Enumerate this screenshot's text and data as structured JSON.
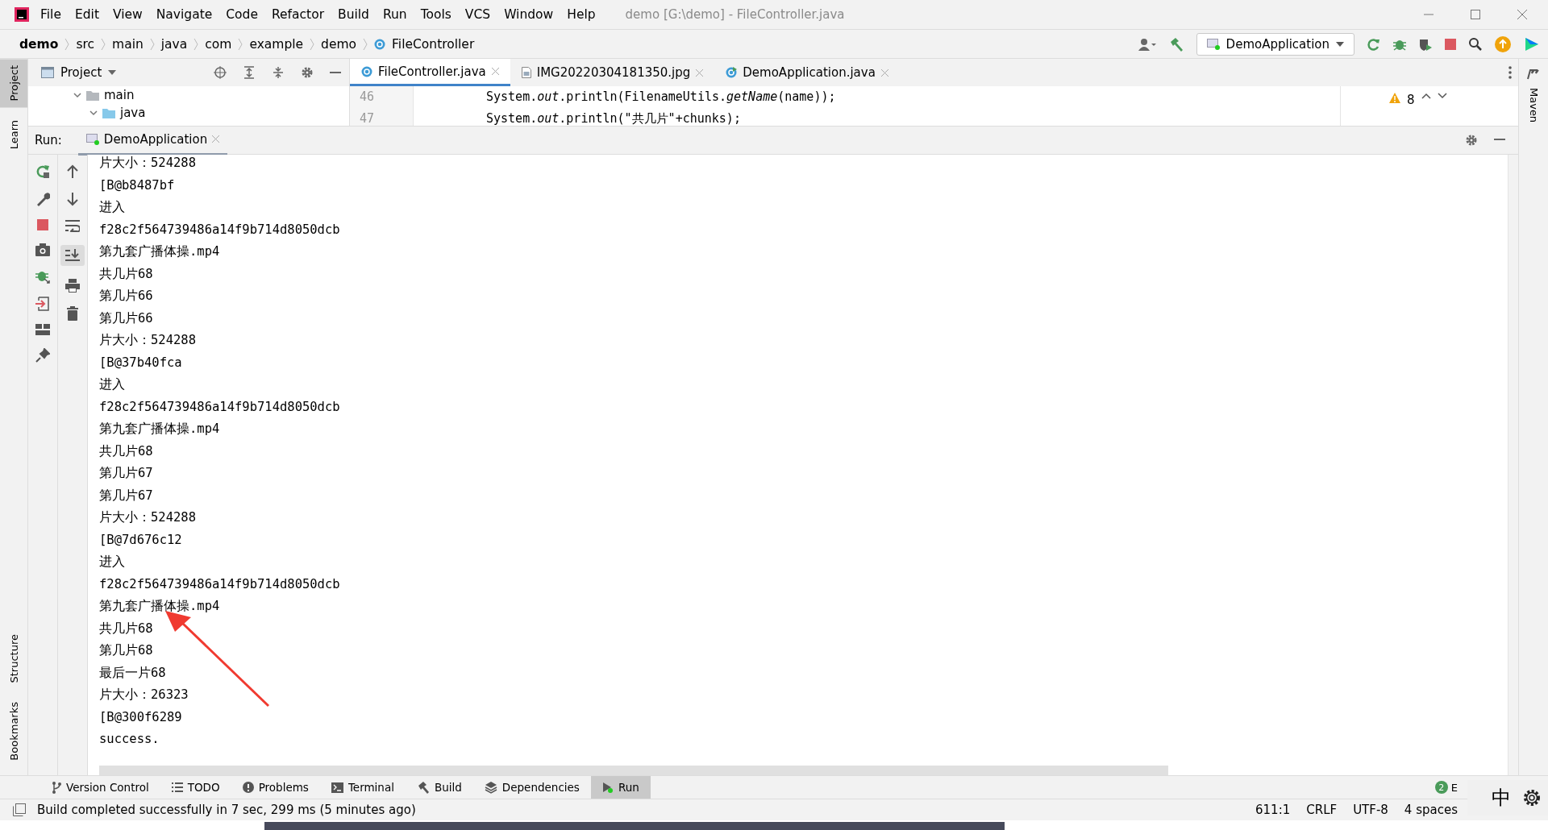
{
  "window": {
    "title": "demo [G:\\demo] - FileController.java"
  },
  "menu": [
    "File",
    "Edit",
    "View",
    "Navigate",
    "Code",
    "Refactor",
    "Build",
    "Run",
    "Tools",
    "VCS",
    "Window",
    "Help"
  ],
  "breadcrumbs": [
    {
      "label": "demo",
      "kind": "project"
    },
    {
      "label": "src",
      "kind": "folder"
    },
    {
      "label": "main",
      "kind": "folder"
    },
    {
      "label": "java",
      "kind": "folder"
    },
    {
      "label": "com",
      "kind": "folder"
    },
    {
      "label": "example",
      "kind": "folder"
    },
    {
      "label": "demo",
      "kind": "folder"
    },
    {
      "label": "FileController",
      "kind": "class"
    }
  ],
  "run_configuration": "DemoApplication",
  "left_strip": [
    {
      "label": "Project",
      "selected": true
    },
    {
      "label": "Learn",
      "selected": false
    }
  ],
  "left_strip_bottom": [
    {
      "label": "Structure",
      "selected": false
    },
    {
      "label": "Bookmarks",
      "selected": false
    }
  ],
  "right_strip": [
    {
      "label": "Maven",
      "selected": false
    }
  ],
  "project_panel": {
    "title": "Project",
    "tree": [
      {
        "label": "main",
        "expanded": true,
        "children": [
          {
            "label": "java",
            "expanded": true
          }
        ]
      }
    ]
  },
  "editor_tabs": [
    {
      "label": "FileController.java",
      "kind": "class",
      "selected": true
    },
    {
      "label": "IMG20220304181350.jpg",
      "kind": "image",
      "selected": false
    },
    {
      "label": "DemoApplication.java",
      "kind": "app",
      "selected": false
    }
  ],
  "code_lines": [
    {
      "number": "46",
      "code": "System.*out*.println(FilenameUtils.*getName*(name));"
    },
    {
      "number": "47",
      "code": "System.*out*.println(\"共几片\"+chunks);"
    }
  ],
  "warnings": "8",
  "run_panel": {
    "label": "Run:",
    "tab": "DemoApplication",
    "console": [
      "片大小：524288",
      "[B@b8487bf",
      "进入",
      "f28c2f564739486a14f9b714d8050dcb",
      "第九套广播体操.mp4",
      "共几片68",
      "第几片66",
      "第几片66",
      "片大小：524288",
      "[B@37b40fca",
      "进入",
      "f28c2f564739486a14f9b714d8050dcb",
      "第九套广播体操.mp4",
      "共几片68",
      "第几片67",
      "第几片67",
      "片大小：524288",
      "[B@7d676c12",
      "进入",
      "f28c2f564739486a14f9b714d8050dcb",
      "第九套广播体操.mp4",
      "共几片68",
      "第几片68",
      "最后一片68",
      "片大小：26323",
      "[B@300f6289",
      "success."
    ]
  },
  "bottom_tabs": [
    {
      "label": "Version Control",
      "kind": "vcs",
      "selected": false
    },
    {
      "label": "TODO",
      "kind": "todo",
      "selected": false
    },
    {
      "label": "Problems",
      "kind": "problems",
      "selected": false
    },
    {
      "label": "Terminal",
      "kind": "terminal",
      "selected": false
    },
    {
      "label": "Build",
      "kind": "build",
      "selected": false
    },
    {
      "label": "Dependencies",
      "kind": "deps",
      "selected": false
    },
    {
      "label": "Run",
      "kind": "run",
      "selected": true
    }
  ],
  "notifications": {
    "count": "2",
    "label": "E"
  },
  "ime": "中",
  "status_bar": {
    "message": "Build completed successfully in 7 sec, 299 ms (5 minutes ago)",
    "items": [
      "611:1",
      "CRLF",
      "UTF-8",
      "4 spaces"
    ]
  }
}
